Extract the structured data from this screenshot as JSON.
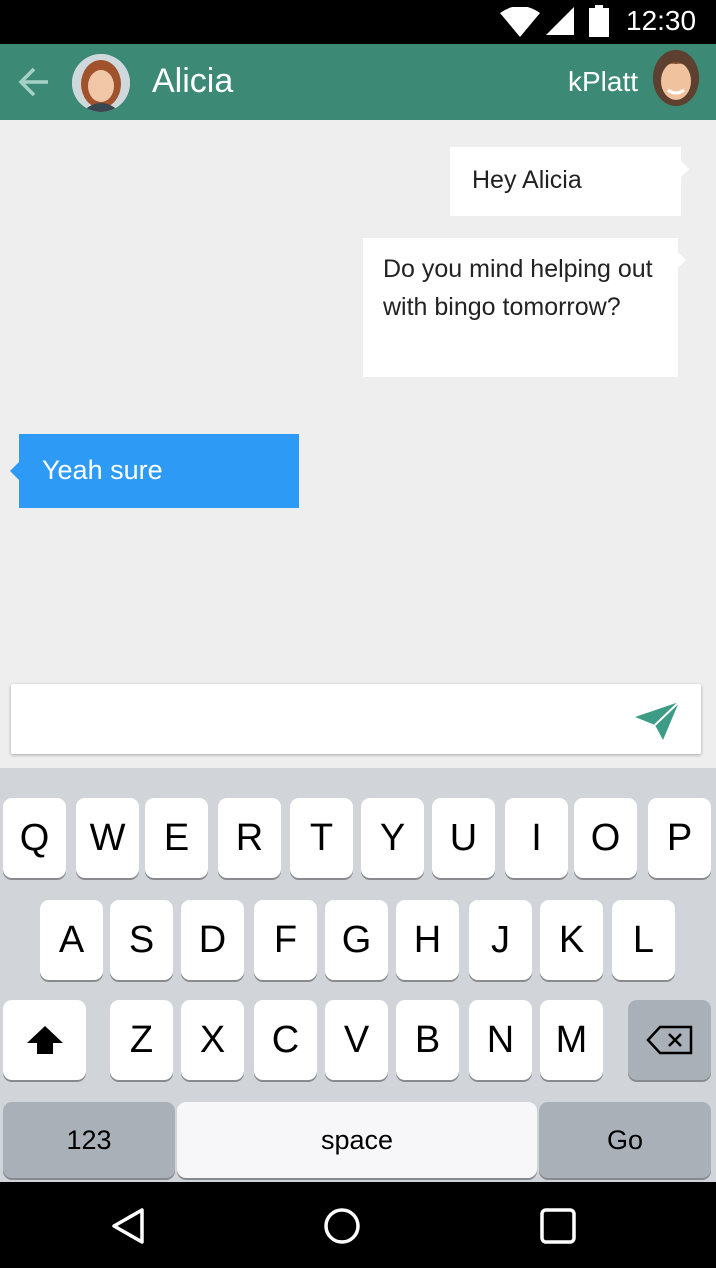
{
  "status_bar": {
    "time": "12:30",
    "icons": [
      "wifi-icon",
      "signal-icon",
      "battery-icon"
    ]
  },
  "app_bar": {
    "contact_name": "Alicia",
    "user_name": "kPlatt",
    "color": "#3c8a75"
  },
  "messages": [
    {
      "direction": "outgoing",
      "text": "Hey Alicia"
    },
    {
      "direction": "outgoing",
      "text": "Do you mind helping out with bingo tomorrow?"
    },
    {
      "direction": "incoming",
      "text": "Yeah sure"
    }
  ],
  "composer": {
    "value": "",
    "placeholder": "",
    "send_icon": "send-icon",
    "send_color": "#3c9c85"
  },
  "keyboard": {
    "row1": [
      "Q",
      "W",
      "E",
      "R",
      "T",
      "Y",
      "U",
      "I",
      "O",
      "P"
    ],
    "row2": [
      "A",
      "S",
      "D",
      "F",
      "G",
      "H",
      "J",
      "K",
      "L"
    ],
    "row3": [
      "Z",
      "X",
      "C",
      "V",
      "B",
      "N",
      "M"
    ],
    "numbers_label": "123",
    "space_label": "space",
    "go_label": "Go"
  },
  "colors": {
    "incoming_bubble": "#2d9af5",
    "outgoing_bubble": "#ffffff",
    "chat_background": "#eeeeee"
  }
}
